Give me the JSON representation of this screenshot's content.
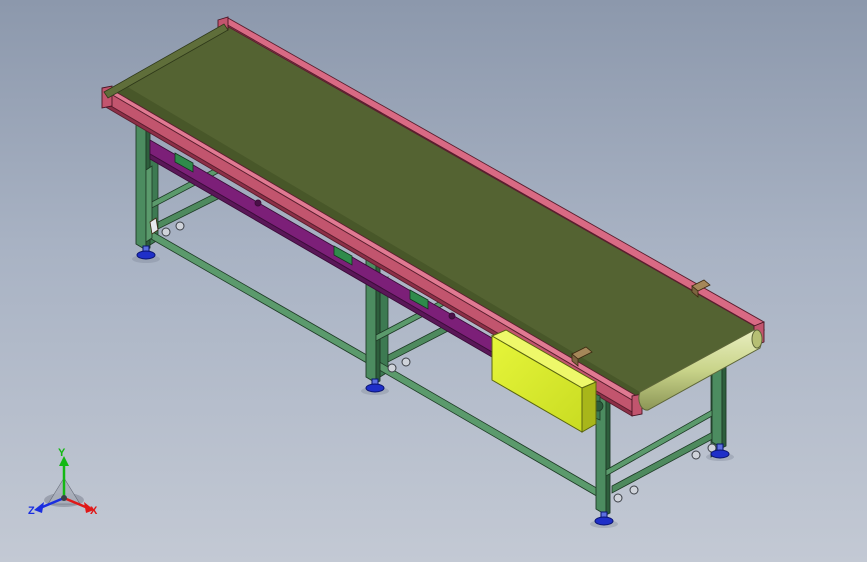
{
  "viewport": {
    "colors": {
      "background_top": "#8c98ac",
      "background_bottom": "#c3c9d4",
      "belt": "#546332",
      "side_rail": "#c2556e",
      "skirt": "#7c1f78",
      "frame": "#3d7a52",
      "feet": "#1f2fc8",
      "control_box": "#d9ee2a",
      "roller": "#c9d48a"
    }
  },
  "triad": {
    "x_label": "X",
    "y_label": "Y",
    "z_label": "Z",
    "x_color": "#e01818",
    "y_color": "#14b814",
    "z_color": "#1a2ee0"
  }
}
